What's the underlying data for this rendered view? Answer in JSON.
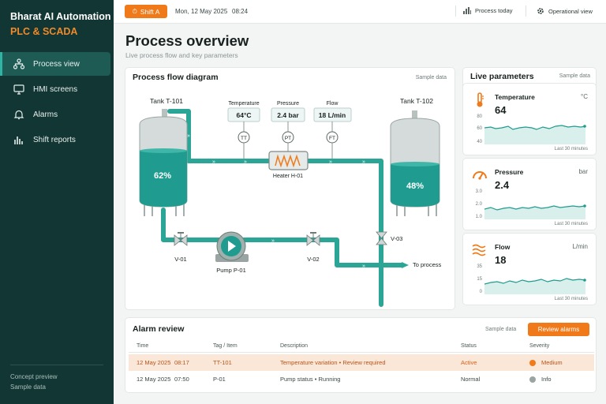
{
  "brand": {
    "line1": "Bharat AI Automation",
    "line2": "PLC & SCADA"
  },
  "sidebar": {
    "items": [
      {
        "label": "Process view",
        "icon": "network-icon",
        "active": true
      },
      {
        "label": "HMI screens",
        "icon": "monitor-icon",
        "active": false
      },
      {
        "label": "Alarms",
        "icon": "bell-icon",
        "active": false
      },
      {
        "label": "Shift reports",
        "icon": "bar-chart-icon",
        "active": false
      }
    ],
    "footer": {
      "line1": "Concept preview",
      "line2": "Sample data"
    }
  },
  "topbar": {
    "shift": "Shift A",
    "date": "Mon, 12 May 2025",
    "time": "08:24",
    "process_today": "Process today",
    "operational_view": "Operational view"
  },
  "page": {
    "title": "Process overview",
    "subtitle": "Live process flow and key parameters"
  },
  "flow": {
    "title": "Process flow diagram",
    "sample": "Sample data",
    "tank1": {
      "label": "Tank T-101",
      "level": "62%"
    },
    "tank2": {
      "label": "Tank T-102",
      "level": "48%"
    },
    "instruments": [
      {
        "label": "Temperature",
        "value": "64°C",
        "tag": "TT"
      },
      {
        "label": "Pressure",
        "value": "2.4 bar",
        "tag": "PT"
      },
      {
        "label": "Flow",
        "value": "18 L/min",
        "tag": "FT"
      }
    ],
    "heater": "Heater H-01",
    "pump": "Pump P-01",
    "valves": {
      "v1": "V-01",
      "v2": "V-02",
      "v3": "V-03"
    },
    "outlet": "To process"
  },
  "live": {
    "title": "Live parameters",
    "sample": "Sample data",
    "params": [
      {
        "name": "Temperature",
        "value": "64",
        "unit": "°C",
        "ticks": [
          "80",
          "60",
          "40"
        ],
        "footer": "Last 30 minutes",
        "icon": "thermometer-icon"
      },
      {
        "name": "Pressure",
        "value": "2.4",
        "unit": "bar",
        "ticks": [
          "3.0",
          "2.0",
          "1.0"
        ],
        "footer": "Last 30 minutes",
        "icon": "gauge-icon"
      },
      {
        "name": "Flow",
        "value": "18",
        "unit": "L/min",
        "ticks": [
          "35",
          "15",
          "0"
        ],
        "footer": "Last 30 minutes",
        "icon": "waves-icon"
      }
    ]
  },
  "alarms": {
    "title": "Alarm review",
    "sample": "Sample data",
    "button": "Review alarms",
    "headers": {
      "time": "Time",
      "tag": "Tag / Item",
      "desc": "Description",
      "status": "Status",
      "severity": "Severity"
    },
    "rows": [
      {
        "date": "12 May 2025",
        "time": "08:17",
        "tag": "TT-101",
        "desc": "Temperature variation • Review required",
        "status": "Active",
        "severity": "Medium",
        "highlight": true
      },
      {
        "date": "12 May 2025",
        "time": "07:50",
        "tag": "P-01",
        "desc": "Pump status • Running",
        "status": "Normal",
        "severity": "Info",
        "highlight": false
      }
    ]
  },
  "colors": {
    "accent": "#f07a1a",
    "teal": "#1f9c8f",
    "sidebar": "#123633"
  }
}
